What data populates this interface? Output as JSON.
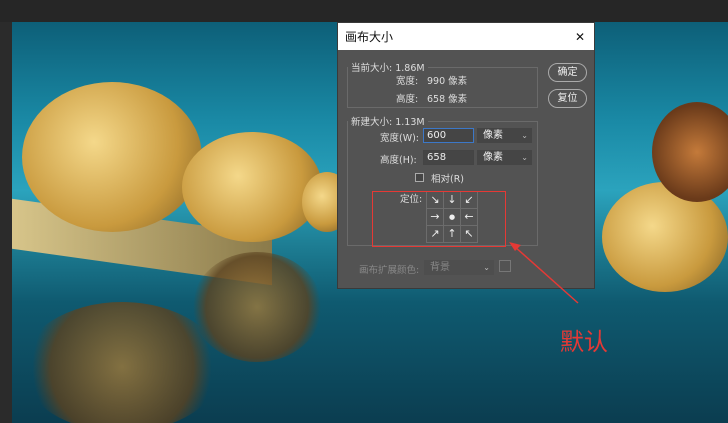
{
  "dialog": {
    "title": "画布大小",
    "close": "✕",
    "current": {
      "legend": "当前大小: 1.86M",
      "width_label": "宽度:",
      "width_value": "990 像素",
      "height_label": "高度:",
      "height_value": "658 像素"
    },
    "new": {
      "legend": "新建大小: 1.13M",
      "width_label": "宽度(W):",
      "width_value": "600",
      "width_unit": "像素",
      "height_label": "高度(H):",
      "height_value": "658",
      "height_unit": "像素",
      "relative_label": "相对(R)",
      "anchor_label": "定位:",
      "anchor": [
        "↘",
        "↓",
        "↙",
        "→",
        "●",
        "←",
        "↗",
        "↑",
        "↖"
      ]
    },
    "ok": "确定",
    "reset": "复位",
    "ext_color_label": "画布扩展颜色:",
    "ext_color_value": "背景"
  },
  "annotation": {
    "text": "默认",
    "color": "#e53935"
  }
}
